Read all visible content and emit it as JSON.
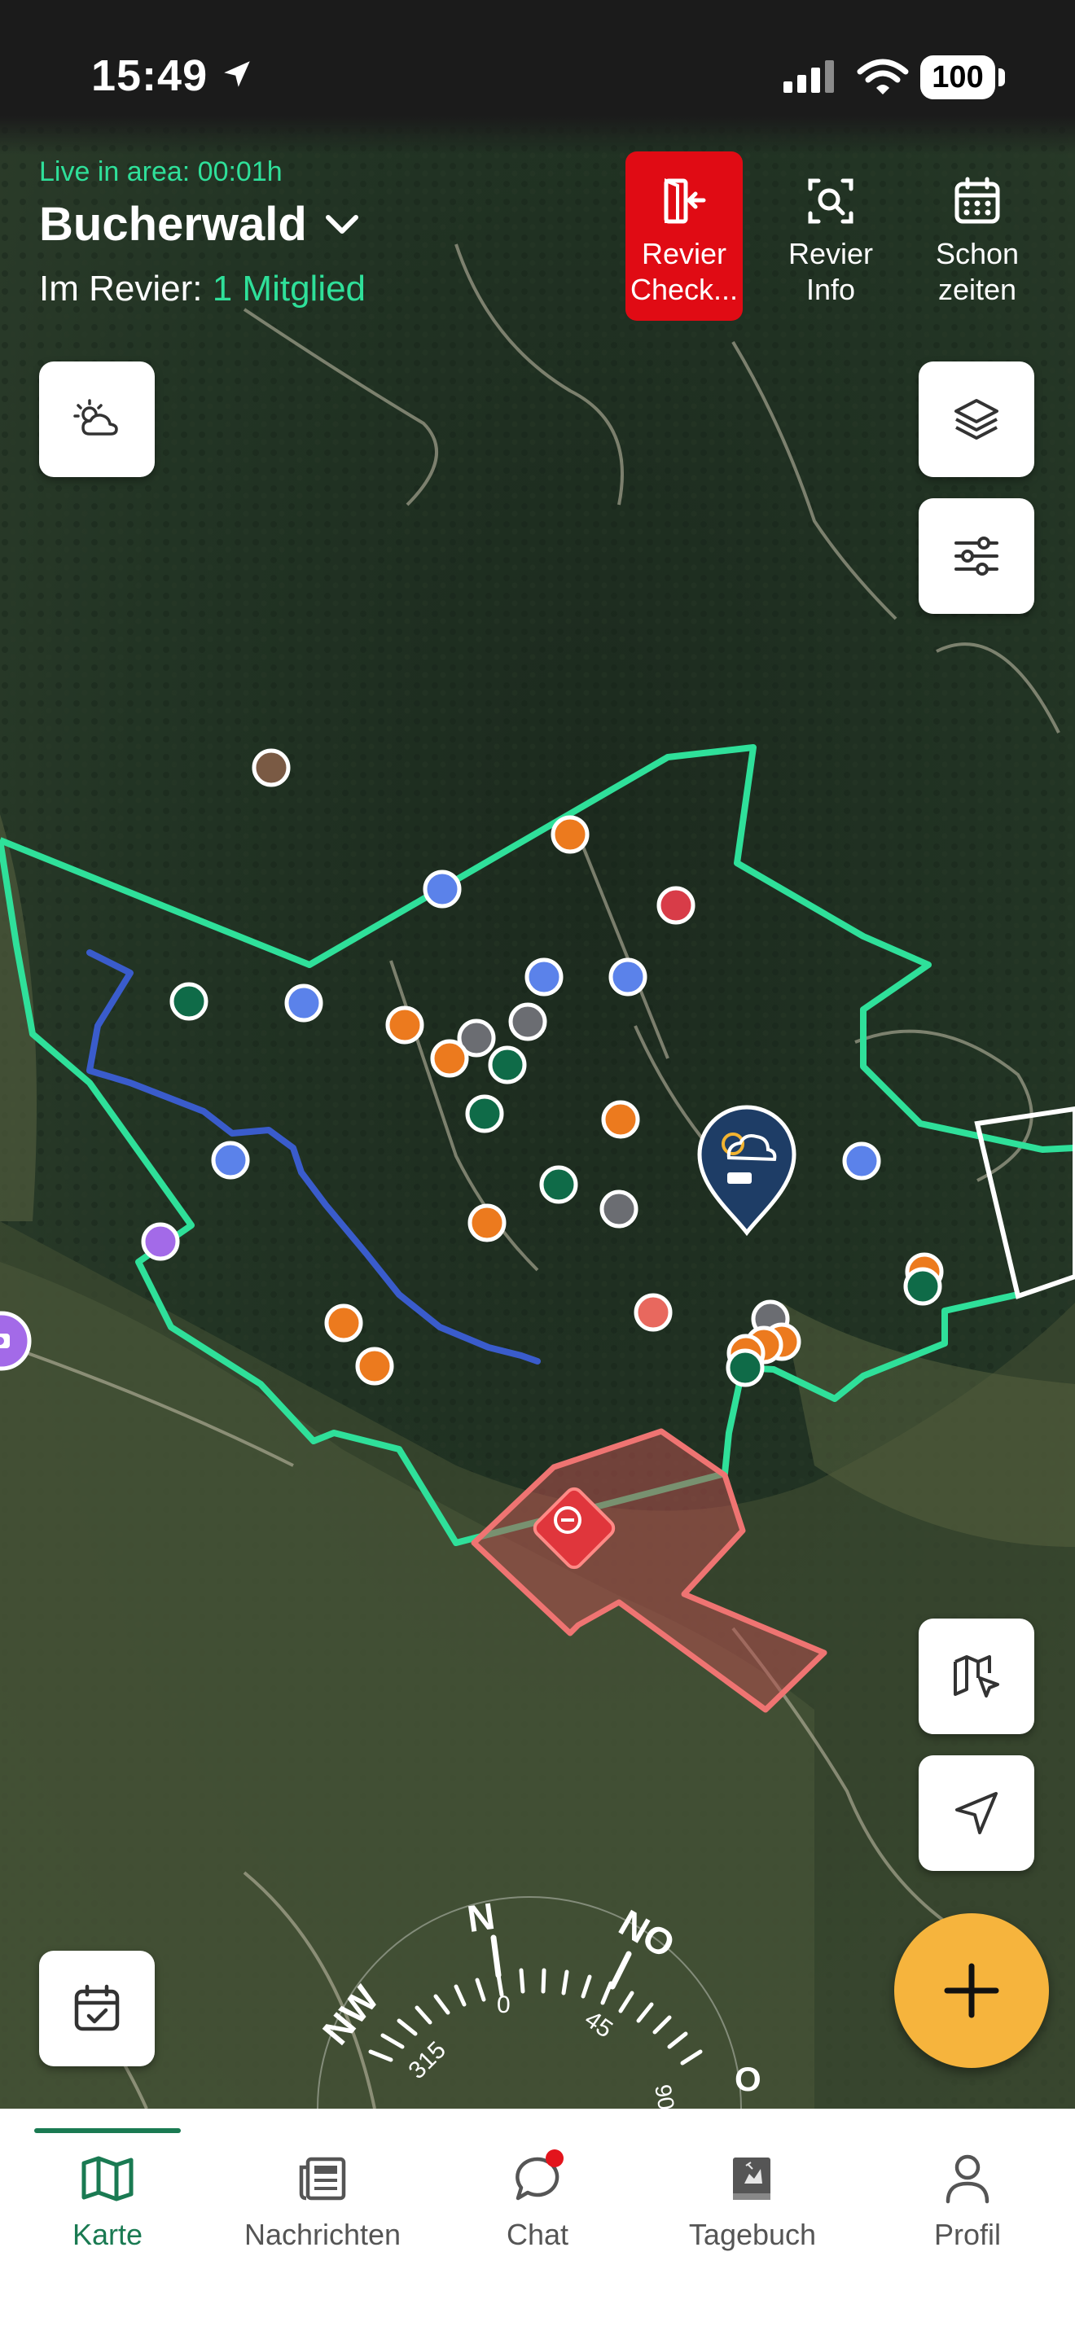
{
  "status": {
    "time": "15:49",
    "battery": "100"
  },
  "header": {
    "live_label": "Live in area: 00:01h",
    "area_name": "Bucherwald",
    "members_prefix": "Im Revier:",
    "members_count": "1 Mitglied"
  },
  "header_buttons": {
    "checkout": {
      "line1": "Revier",
      "line2": "Check..."
    },
    "info": {
      "line1": "Revier",
      "line2": "Info"
    },
    "schonzeiten": {
      "line1": "Schon",
      "line2": "zeiten"
    }
  },
  "compass": {
    "n": "N",
    "no": "NO",
    "nw": "NW",
    "o": "O",
    "deg_0": "0",
    "deg_45": "45",
    "deg_315": "315",
    "deg_90": "90"
  },
  "nav": {
    "karte": "Karte",
    "nachrichten": "Nachrichten",
    "chat": "Chat",
    "tagebuch": "Tagebuch",
    "profil": "Profil"
  },
  "colors": {
    "accent": "#1a7a52",
    "live_green": "#2fe09a",
    "boundary": "#2fe09a",
    "stream": "#3a5ccc",
    "restricted": "#e56a6a",
    "checkout_red": "#e00b14",
    "fab": "#f6b43d",
    "marker_orange": "#ec7a1e",
    "marker_blue": "#5b82ea",
    "marker_green": "#0f6b48",
    "marker_gray": "#6b6d72",
    "marker_red": "#d83c48",
    "marker_salmon": "#e8685e",
    "marker_purple": "#a36ae8",
    "marker_brown": "#7a5a44"
  }
}
